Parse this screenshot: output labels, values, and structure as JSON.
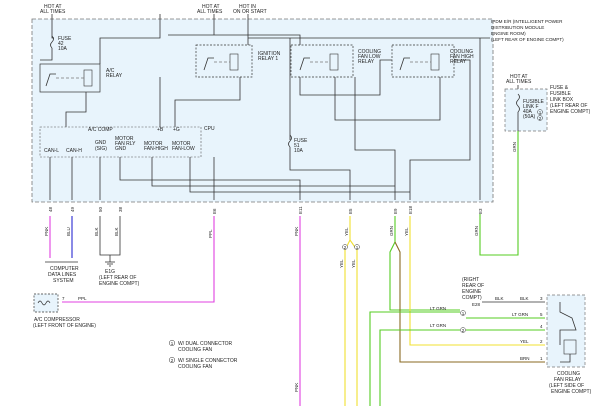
{
  "ipdm": {
    "title_lines": [
      "IPDM E/R (INTELLIGENT POWER",
      "DISTRIBUTION MODULE",
      "ENGINE ROOM)",
      "(LEFT REAR OF ENGINE COMPT)"
    ],
    "hot_at_all_times": [
      "HOT AT",
      "ALL TIMES"
    ],
    "hot_in_on": [
      "HOT IN",
      "ON OR START"
    ],
    "fuse_42": [
      "FUSE",
      "42",
      "10A"
    ],
    "fuse_51": [
      "FUSE",
      "51",
      "10A"
    ],
    "ac_relay": [
      "A/C",
      "RELAY"
    ],
    "ignition_relay": [
      "IGNITION",
      "RELAY 1"
    ],
    "cooling_low_relay": [
      "COOLING",
      "FAN LOW",
      "RELAY"
    ],
    "cooling_high_relay": [
      "COOLING",
      "FAN HIGH",
      "RELAY"
    ],
    "cpu": "CPU",
    "ac_comp": "A/C COMP",
    "plus_b": "+B",
    "plus_g": "+G",
    "pins": {
      "can_l": "CAN-L",
      "can_h": "CAN-H",
      "gnd_sig": [
        "GND",
        "(SIG)"
      ],
      "motor_fan_rly_gnd": [
        "MOTOR",
        "FAN RLY",
        "GND"
      ],
      "motor_fan_high": [
        "MOTOR",
        "FAN-HIGH"
      ],
      "motor_fan_low": [
        "MOTOR",
        "FAN-LOW"
      ]
    },
    "terminals": [
      "48",
      "49",
      "50",
      "38",
      "E6",
      "E7",
      "E22",
      "E17",
      "E11",
      "E5",
      "E9",
      "E18",
      "E15",
      "E3"
    ]
  },
  "fusible_link": {
    "hot": [
      "HOT AT",
      "ALL TIMES"
    ],
    "label": [
      "FUSE &",
      "FUSIBLE",
      "LINK BOX",
      "(LEFT REAR OF",
      "ENGINE COMPT)"
    ],
    "link": [
      "FUSIBLE",
      "LINK F",
      "40A",
      "(50A)"
    ],
    "circles": [
      "1",
      "2"
    ],
    "wire": "GRN"
  },
  "wires": {
    "pnk": "PNK",
    "blu": "BLU",
    "blk": "BLK",
    "ppl": "PPL",
    "yel": "YEL",
    "grn": "GRN",
    "lt_grn": "LT GRN",
    "brn": "BRN",
    "ppl_e22": "PPL E22"
  },
  "computer_data_lines": [
    "COMPUTER",
    "DATA LINES",
    "SYSTEM"
  ],
  "ground_e1g": [
    "E1G",
    "(LEFT REAR OF",
    "ENGINE COMPT)"
  ],
  "ac_compressor": [
    "A/C COMPRESSOR",
    "(LEFT FRONT OF ENGINE)"
  ],
  "right_rear": [
    "(RIGHT",
    "REAR OF",
    "ENGINE",
    "COMPT)"
  ],
  "fan_relay": [
    "COOLING",
    "FAN RELAY",
    "(LEFT SIDE OF",
    "ENGINE COMPT)"
  ],
  "e28": "E28",
  "legend": {
    "note1_num": "1",
    "note1": [
      "W/ DUAL CONNECTOR",
      "COOLING FAN"
    ],
    "note2_num": "2",
    "note2": [
      "W/ SINGLE CONNECTOR",
      "COOLING FAN"
    ]
  },
  "pin_numbers": [
    "1",
    "2",
    "3",
    "4",
    "5",
    "6",
    "7"
  ],
  "colors": {
    "pink": "#e040e0",
    "blue": "#2a2ad0",
    "green": "#55cc22",
    "yellow": "#f0e030",
    "brown": "#8a6a22",
    "box_fill": "#e8f4fc"
  }
}
